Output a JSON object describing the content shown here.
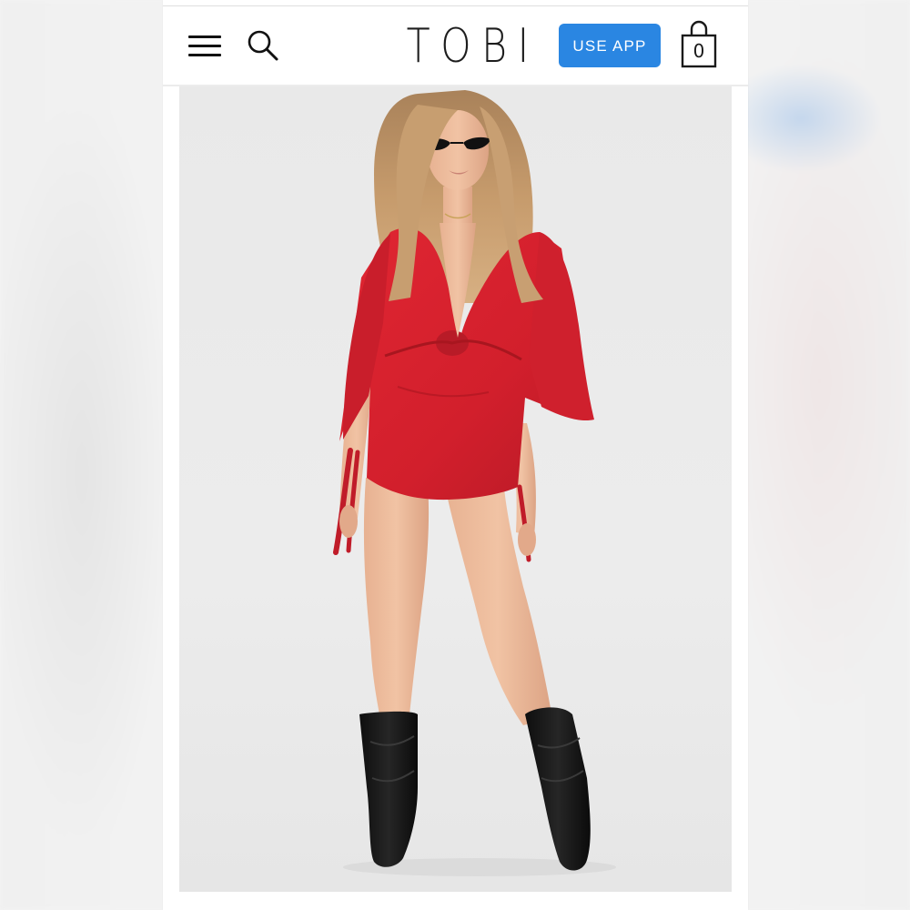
{
  "header": {
    "logo_text": "TOBI",
    "use_app_label": "USE APP",
    "cart_count": "0",
    "icons": {
      "menu": "hamburger-menu-icon",
      "search": "search-icon",
      "cart": "shopping-bag-icon"
    }
  },
  "product": {
    "image": "model-red-romper-photo"
  },
  "colors": {
    "accent": "#2a86e2",
    "romper": "#d8222e",
    "background": "#ececec"
  }
}
